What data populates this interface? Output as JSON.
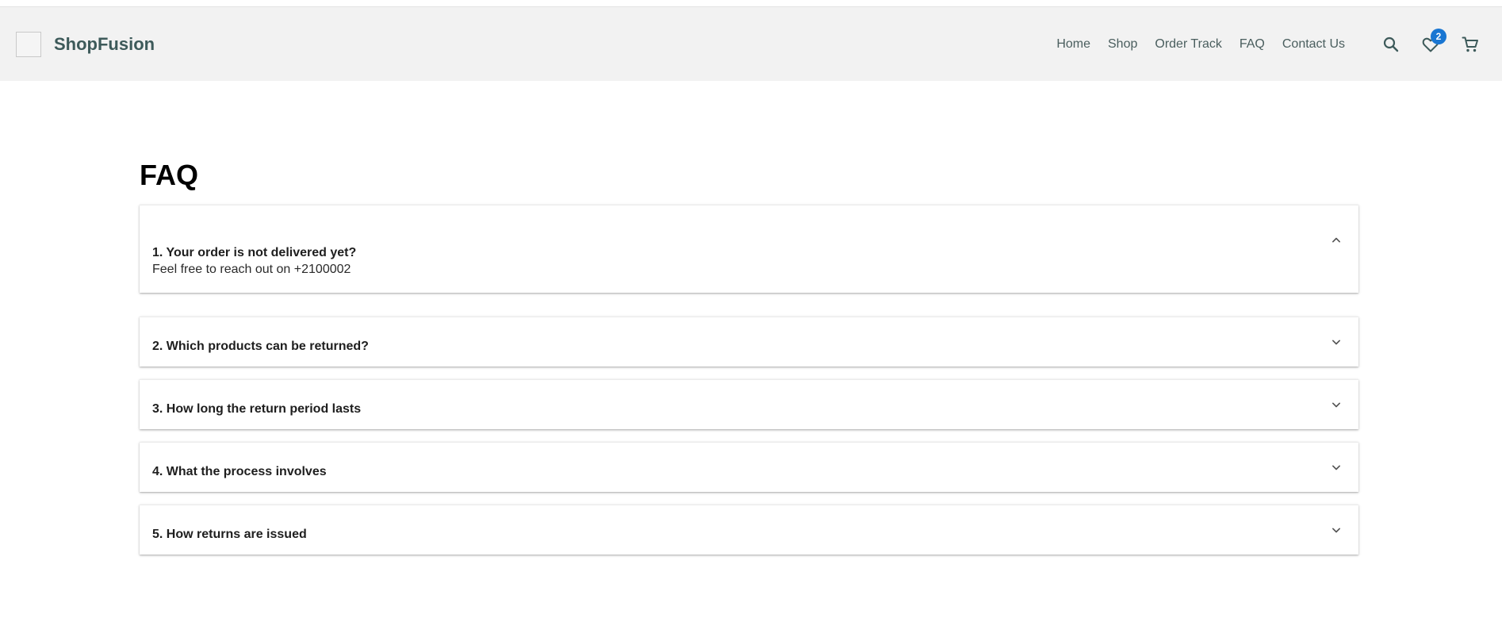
{
  "brand": {
    "name": "ShopFusion"
  },
  "nav": {
    "items": [
      {
        "label": "Home"
      },
      {
        "label": "Shop"
      },
      {
        "label": "Order Track"
      },
      {
        "label": "FAQ"
      },
      {
        "label": "Contact Us"
      }
    ]
  },
  "header_icons": {
    "search": "search-icon",
    "wishlist": "heart-icon",
    "wishlist_count": "2",
    "cart": "cart-icon",
    "accent_color": "#1976d2"
  },
  "page": {
    "title": "FAQ"
  },
  "faq": {
    "items": [
      {
        "question": "1. Your order is not delivered yet?",
        "answer": "Feel free to reach out on +2100002",
        "expanded": true
      },
      {
        "question": "2. Which products can be returned?",
        "expanded": false
      },
      {
        "question": "3. How long the return period lasts",
        "expanded": false
      },
      {
        "question": "4. What the process involves",
        "expanded": false
      },
      {
        "question": "5. How returns are issued",
        "expanded": false
      }
    ]
  }
}
